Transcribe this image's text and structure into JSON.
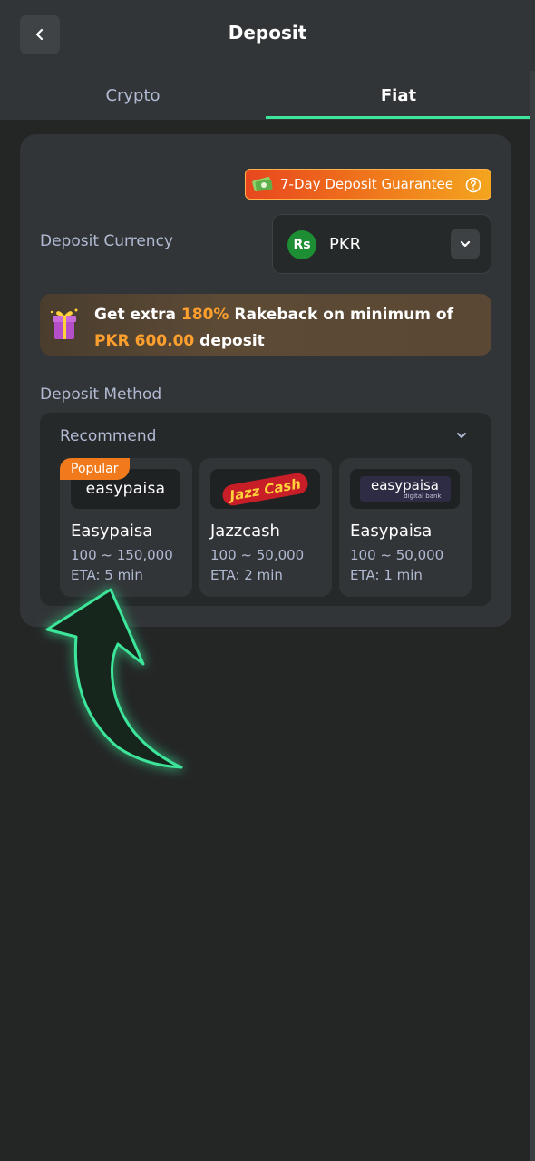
{
  "header": {
    "title": "Deposit",
    "back_icon": "chevron-left-icon"
  },
  "tabs": [
    {
      "label": "Crypto",
      "active": false
    },
    {
      "label": "Fiat",
      "active": true
    }
  ],
  "guarantee": {
    "label": "7-Day Deposit Guarantee",
    "icon": "money-icon",
    "help_icon": "question-circle-icon"
  },
  "currency": {
    "label": "Deposit Currency",
    "symbol": "Rs",
    "code": "PKR",
    "dropdown_icon": "chevron-down-icon"
  },
  "promo": {
    "icon": "gift-icon",
    "text_1": "Get extra ",
    "highlight_1": "180%",
    "text_2": " Rakeback on minimum of ",
    "highlight_2": "PKR 600.00",
    "text_3": " deposit"
  },
  "method": {
    "label": "Deposit Method",
    "group_label": "Recommend",
    "items": [
      {
        "logo_text": "easypaisa",
        "name": "Easypaisa",
        "range": "100 ~ 150,000",
        "eta": "ETA: 5 min",
        "tag": "Popular"
      },
      {
        "logo_text": "Jazz Cash",
        "name": "Jazzcash",
        "range": "100 ~ 50,000",
        "eta": "ETA: 2 min"
      },
      {
        "logo_text": "easypaisa",
        "logo_sub": "digital bank",
        "name": "Easypaisa",
        "range": "100 ~ 50,000",
        "eta": "ETA: 1 min"
      }
    ]
  },
  "colors": {
    "accent": "#3ee59a",
    "orange": "#ffa02e",
    "background": "#242626",
    "card": "#323537"
  }
}
